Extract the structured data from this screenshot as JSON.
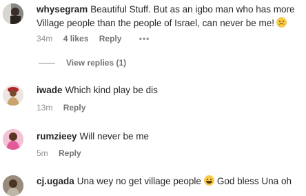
{
  "comments": [
    {
      "user": "whysegram",
      "text_line1": "Beautiful Stuff. But as an igbo man who has more",
      "text_line2": "Village people than the people of Israel, can never be me!",
      "time": "34m",
      "likes": "4 likes",
      "reply": "Reply",
      "more": "•••",
      "emoji": "sad-face-emoji"
    },
    {
      "user": "iwade",
      "text": "Which kind play be dis",
      "time": "13m",
      "reply": "Reply"
    },
    {
      "user": "rumzieey",
      "text": "Will never be me",
      "time": "5m",
      "reply": "Reply"
    },
    {
      "user": "cj.ugada",
      "text_before": "Una wey no get village people",
      "text_after": "God bless Una oh",
      "emoji": "laughing-face-emoji"
    }
  ],
  "view_replies": "View replies (1)",
  "colors": {
    "text": "#262626",
    "meta": "#8e8e8e",
    "background": "#ffffff"
  }
}
